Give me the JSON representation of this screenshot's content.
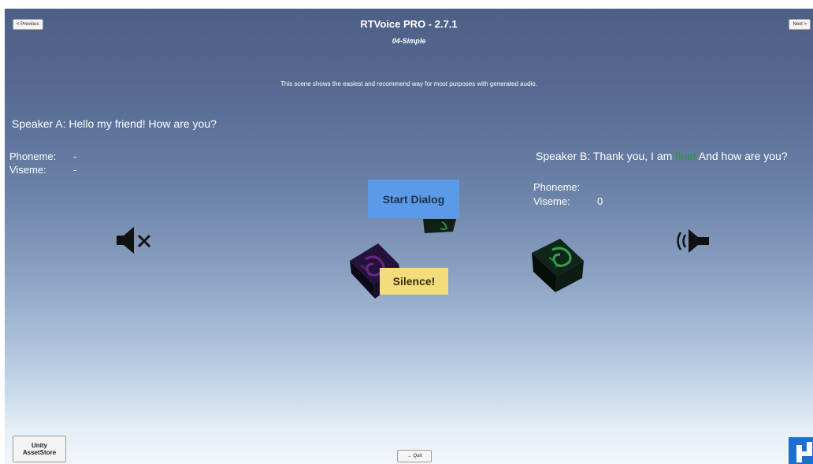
{
  "nav": {
    "previous_label": "< Previous",
    "next_label": "Next >"
  },
  "header": {
    "title": "RTVoice PRO - 2.7.1",
    "subtitle": "04-Simple",
    "description": "This scene shows the easiest and recommend way for most purposes with generated audio."
  },
  "speaker_a": {
    "text": "Speaker A: Hello my friend! How are you?",
    "phoneme_label": "Phoneme:",
    "phoneme_value": "-",
    "viseme_label": "Viseme:",
    "viseme_value": "-",
    "icon": "speaker-muted-icon"
  },
  "speaker_b": {
    "text_before": "Speaker B: Thank you, I am ",
    "text_highlight": "fine!",
    "text_after": " And how are you?",
    "highlight_color": "#2a9a2a",
    "phoneme_label": "Phoneme:",
    "phoneme_value": "",
    "viseme_label": "Viseme:",
    "viseme_value": "0",
    "icon": "speaker-playing-icon"
  },
  "buttons": {
    "start_dialog": "Start Dialog",
    "silence": "Silence!",
    "quit": "Quit",
    "assetstore_line1": "Unity",
    "assetstore_line2": "AssetStore"
  },
  "colors": {
    "start_dialog_bg": "#5b9ae6",
    "silence_bg": "#f3dc7c",
    "sky_top": "#4d5f85",
    "sky_bottom": "#f2f6fa"
  }
}
